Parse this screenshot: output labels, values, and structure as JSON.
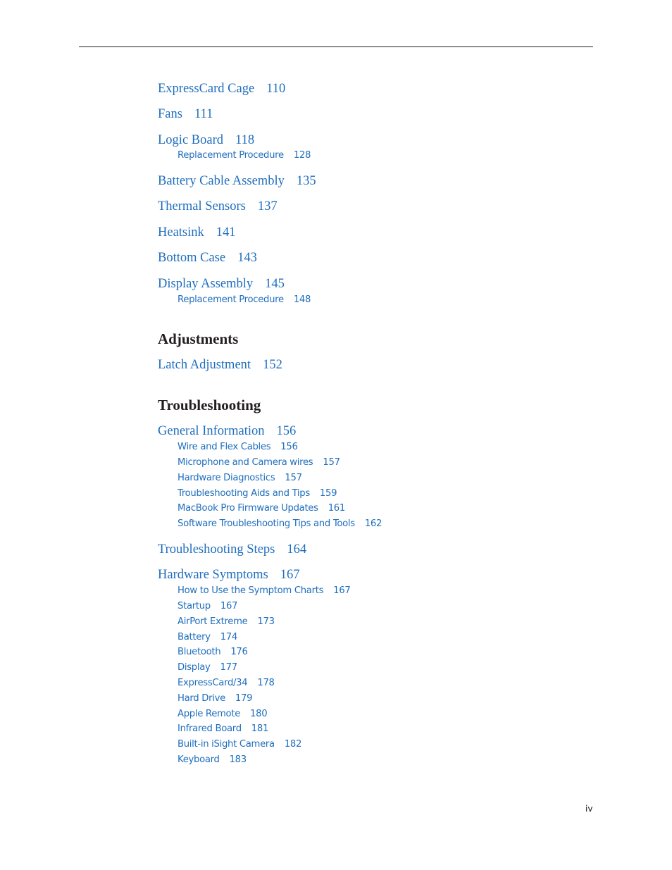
{
  "document": {
    "folio": "iv",
    "colors": {
      "link": "#1f6ebd",
      "heading": "#231f20",
      "rule": "#231f20"
    }
  },
  "toc": {
    "e0": {
      "title": "ExpressCard Cage",
      "page": "110"
    },
    "e1": {
      "title": "Fans",
      "page": "111"
    },
    "e2": {
      "title": "Logic Board",
      "page": "118"
    },
    "e2a": {
      "title": "Replacement Procedure",
      "page": "128"
    },
    "e3": {
      "title": "Battery Cable Assembly",
      "page": "135"
    },
    "e4": {
      "title": "Thermal Sensors",
      "page": "137"
    },
    "e5": {
      "title": "Heatsink",
      "page": "141"
    },
    "e6": {
      "title": "Bottom Case",
      "page": "143"
    },
    "e7": {
      "title": "Display Assembly",
      "page": "145"
    },
    "e7a": {
      "title": "Replacement Procedure",
      "page": "148"
    },
    "h1": {
      "title": "Adjustments"
    },
    "e8": {
      "title": "Latch Adjustment",
      "page": "152"
    },
    "h2": {
      "title": "Troubleshooting"
    },
    "e9": {
      "title": "General Information",
      "page": "156"
    },
    "e9a": {
      "title": "Wire and Flex Cables",
      "page": "156"
    },
    "e9b": {
      "title": "Microphone and Camera wires",
      "page": "157"
    },
    "e9c": {
      "title": "Hardware Diagnostics",
      "page": "157"
    },
    "e9d": {
      "title": "Troubleshooting Aids and Tips",
      "page": "159"
    },
    "e9e": {
      "title": "MacBook Pro Firmware Updates",
      "page": "161"
    },
    "e9f": {
      "title": "Software Troubleshooting Tips and Tools",
      "page": "162"
    },
    "e10": {
      "title": "Troubleshooting Steps",
      "page": "164"
    },
    "e11": {
      "title": "Hardware Symptoms",
      "page": "167"
    },
    "e11a": {
      "title": "How to Use the Symptom Charts",
      "page": "167"
    },
    "e11b": {
      "title": "Startup",
      "page": "167"
    },
    "e11c": {
      "title": "AirPort Extreme",
      "page": "173"
    },
    "e11d": {
      "title": "Battery",
      "page": "174"
    },
    "e11e": {
      "title": "Bluetooth",
      "page": "176"
    },
    "e11f": {
      "title": "Display",
      "page": "177"
    },
    "e11g": {
      "title": "ExpressCard/34",
      "page": "178"
    },
    "e11h": {
      "title": "Hard Drive",
      "page": "179"
    },
    "e11i": {
      "title": "Apple Remote",
      "page": "180"
    },
    "e11j": {
      "title": "Infrared Board",
      "page": "181"
    },
    "e11k": {
      "title": "Built-in iSight Camera",
      "page": "182"
    },
    "e11l": {
      "title": "Keyboard",
      "page": "183"
    }
  }
}
